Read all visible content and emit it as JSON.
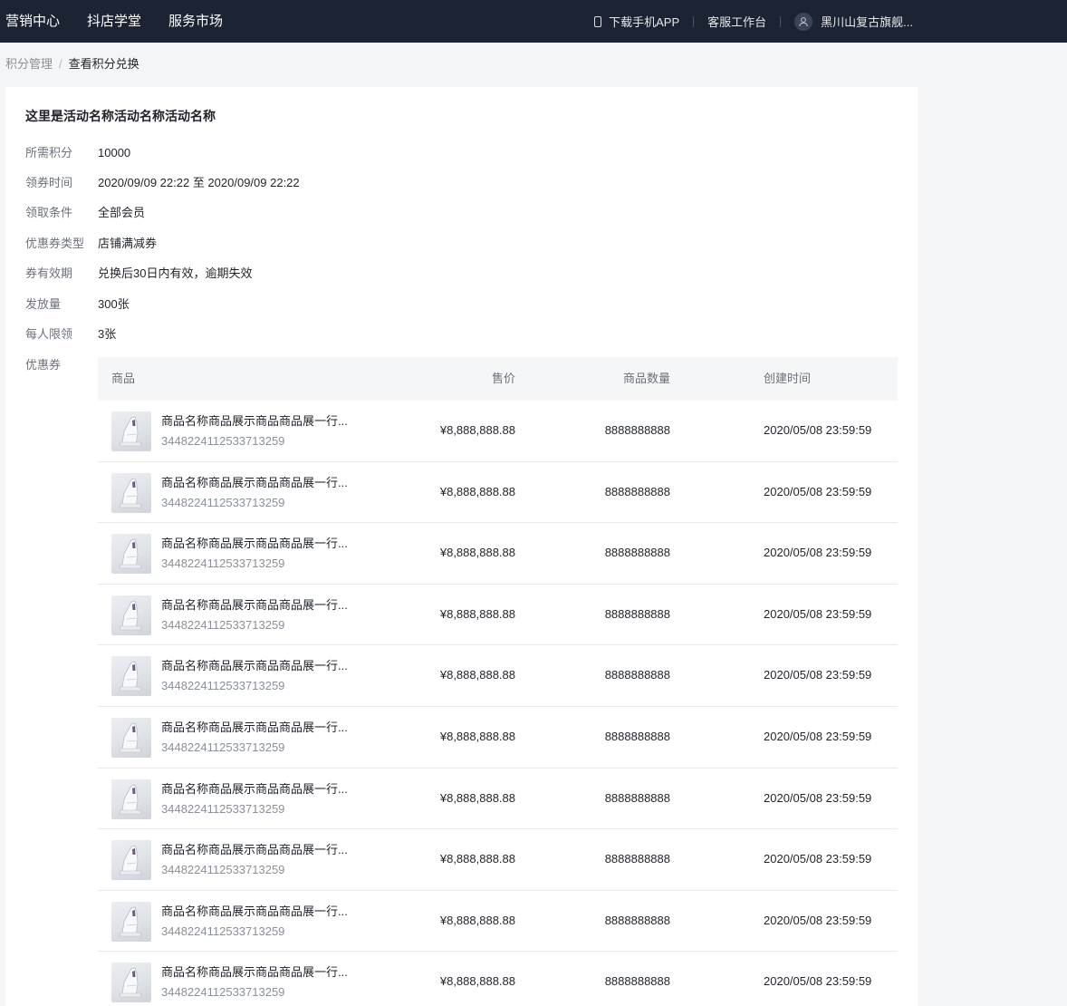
{
  "nav": {
    "items": [
      "营销中心",
      "抖店学堂",
      "服务市场"
    ],
    "download_app": "下载手机APP",
    "service_desk": "客服工作台",
    "user_name": "黑川山复古旗舰..."
  },
  "breadcrumb": {
    "parent": "积分管理",
    "separator": "/",
    "current": "查看积分兑换"
  },
  "activity": {
    "title": "这里是活动名称活动名称活动名称",
    "fields": [
      {
        "label": "所需积分",
        "value": "10000"
      },
      {
        "label": "领券时间",
        "value": "2020/09/09 22:22 至 2020/09/09 22:22"
      },
      {
        "label": "领取条件",
        "value": "全部会员"
      },
      {
        "label": "优惠券类型",
        "value": "店铺满减券"
      },
      {
        "label": "券有效期",
        "value": "兑换后30日内有效，逾期失效"
      },
      {
        "label": "发放量",
        "value": "300张"
      },
      {
        "label": "每人限领",
        "value": "3张"
      },
      {
        "label": "优惠券",
        "value": ""
      }
    ]
  },
  "table": {
    "columns": {
      "goods": "商品",
      "price": "售价",
      "quantity": "商品数量",
      "created": "创建时间"
    },
    "rows": [
      {
        "name": "商品名称商品展示商品商品展一行...",
        "id": "3448224112533713259",
        "price": "¥8,888,888.88",
        "quantity": "8888888888",
        "created": "2020/05/08 23:59:59"
      },
      {
        "name": "商品名称商品展示商品商品展一行...",
        "id": "3448224112533713259",
        "price": "¥8,888,888.88",
        "quantity": "8888888888",
        "created": "2020/05/08 23:59:59"
      },
      {
        "name": "商品名称商品展示商品商品展一行...",
        "id": "3448224112533713259",
        "price": "¥8,888,888.88",
        "quantity": "8888888888",
        "created": "2020/05/08 23:59:59"
      },
      {
        "name": "商品名称商品展示商品商品展一行...",
        "id": "3448224112533713259",
        "price": "¥8,888,888.88",
        "quantity": "8888888888",
        "created": "2020/05/08 23:59:59"
      },
      {
        "name": "商品名称商品展示商品商品展一行...",
        "id": "3448224112533713259",
        "price": "¥8,888,888.88",
        "quantity": "8888888888",
        "created": "2020/05/08 23:59:59"
      },
      {
        "name": "商品名称商品展示商品商品展一行...",
        "id": "3448224112533713259",
        "price": "¥8,888,888.88",
        "quantity": "8888888888",
        "created": "2020/05/08 23:59:59"
      },
      {
        "name": "商品名称商品展示商品商品展一行...",
        "id": "3448224112533713259",
        "price": "¥8,888,888.88",
        "quantity": "8888888888",
        "created": "2020/05/08 23:59:59"
      },
      {
        "name": "商品名称商品展示商品商品展一行...",
        "id": "3448224112533713259",
        "price": "¥8,888,888.88",
        "quantity": "8888888888",
        "created": "2020/05/08 23:59:59"
      },
      {
        "name": "商品名称商品展示商品商品展一行...",
        "id": "3448224112533713259",
        "price": "¥8,888,888.88",
        "quantity": "8888888888",
        "created": "2020/05/08 23:59:59"
      },
      {
        "name": "商品名称商品展示商品商品展一行...",
        "id": "3448224112533713259",
        "price": "¥8,888,888.88",
        "quantity": "8888888888",
        "created": "2020/05/08 23:59:59"
      }
    ]
  },
  "icons": {
    "phone": "phone-icon",
    "avatar": "user-avatar-icon",
    "product": "shoe-thumbnail"
  },
  "colors": {
    "topbar": "#1c2433",
    "page_bg": "#f4f5f7",
    "table_header": "#f5f6f7"
  }
}
